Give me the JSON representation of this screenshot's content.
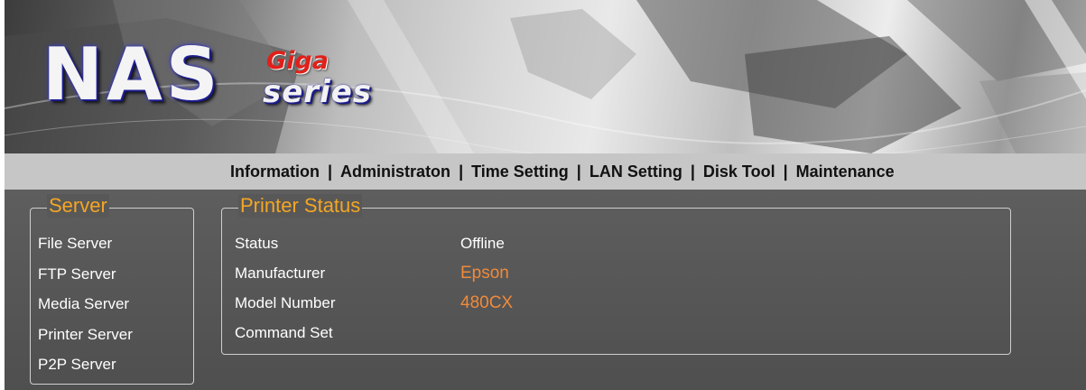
{
  "header": {
    "logo": {
      "main": "NAS",
      "sub_top": "Giga",
      "sub_bottom": "series"
    }
  },
  "nav": {
    "items": [
      {
        "label": "Information"
      },
      {
        "label": "Administraton"
      },
      {
        "label": "Time Setting"
      },
      {
        "label": "LAN Setting"
      },
      {
        "label": "Disk Tool"
      },
      {
        "label": "Maintenance"
      }
    ],
    "separator": "|"
  },
  "sidebar": {
    "title": "Server",
    "items": [
      {
        "label": "File Server"
      },
      {
        "label": "FTP Server"
      },
      {
        "label": "Media Server"
      },
      {
        "label": "Printer Server"
      },
      {
        "label": "P2P Server"
      }
    ]
  },
  "printer_status": {
    "title": "Printer Status",
    "rows": [
      {
        "label": "Status",
        "value": "Offline"
      },
      {
        "label": "Manufacturer",
        "value": "Epson"
      },
      {
        "label": "Model Number",
        "value": "480CX"
      },
      {
        "label": "Command Set",
        "value": ""
      }
    ]
  },
  "colors": {
    "accent": "#f5a623",
    "value_accent": "#f08a3a",
    "nav_bg": "#c6c6c6",
    "content_bg": "#555555"
  }
}
